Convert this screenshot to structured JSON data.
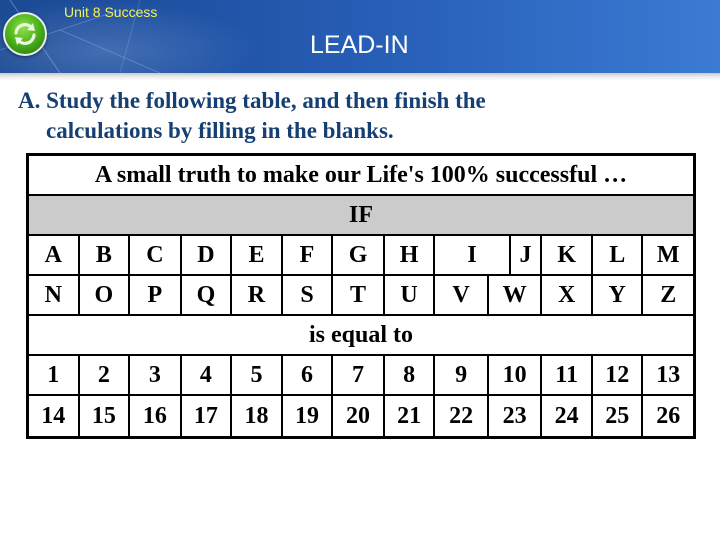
{
  "header": {
    "unit_label": "Unit 8  Success",
    "title": "LEAD-IN",
    "logo_icon": "green-refresh-icon"
  },
  "instruction": {
    "line1": "A. Study the following table, and then finish the",
    "line2": "calculations by filling in the blanks."
  },
  "table": {
    "caption": "A small truth to make our Life's 100% successful …",
    "if_label": "IF",
    "letters_row1": [
      "A",
      "B",
      "C",
      "D",
      "E",
      "F",
      "G",
      "H",
      "I",
      "J",
      "K",
      "L",
      "M"
    ],
    "letters_row2": [
      "N",
      "O",
      "P",
      "Q",
      "R",
      "S",
      "T",
      "U",
      "V",
      "W",
      "X",
      "Y",
      "Z"
    ],
    "equal_label": "is equal to",
    "numbers_row1": [
      "1",
      "2",
      "3",
      "4",
      "5",
      "6",
      "7",
      "8",
      "9",
      "10",
      "11",
      "12",
      "13"
    ],
    "numbers_row2": [
      "14",
      "15",
      "16",
      "17",
      "18",
      "19",
      "20",
      "21",
      "22",
      "23",
      "24",
      "25",
      "26"
    ]
  },
  "colors": {
    "header_blue": "#1f51a3",
    "unit_label_yellow": "#f2f25a",
    "instruction_navy": "#163f73",
    "if_row_gray": "#cbcbcb"
  }
}
